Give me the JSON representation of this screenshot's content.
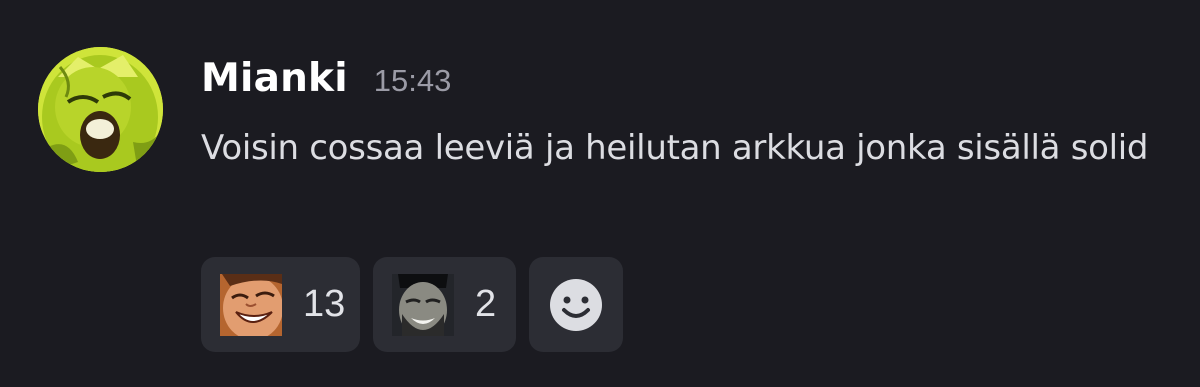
{
  "message": {
    "username": "Mianki",
    "timestamp": "15:43",
    "content": "Voisin cossaa leeviä ja heilutan arkkua jonka sisällä solid",
    "avatar_icon": "green-character-avatar"
  },
  "reactions": [
    {
      "emoji_icon": "laughing-face-emoji",
      "count": "13"
    },
    {
      "emoji_icon": "grinning-man-emoji",
      "count": "2"
    }
  ],
  "add_reaction": {
    "icon": "smiley-add-reaction-icon"
  },
  "colors": {
    "background": "#1b1b21",
    "reaction_bg": "#2c2d34",
    "username": "#ffffff",
    "timestamp": "#9b9ba6",
    "text": "#dcdde2"
  }
}
